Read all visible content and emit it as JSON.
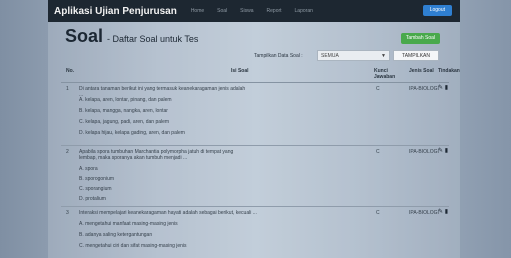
{
  "navbar": {
    "brand": "Aplikasi Ujian Penjurusan",
    "links": [
      "Home",
      "Soal",
      "Siswa",
      "Report",
      "Laporan"
    ],
    "logout_label": "Logout"
  },
  "page": {
    "title": "Soal",
    "subtitle": "- Daftar Soal untuk Tes",
    "add_button": "Tambah Soal",
    "filter_label": "Tampilkan Data Soal :",
    "filter_value": "SEMUA",
    "show_button": "TAMPILKAN"
  },
  "table": {
    "headers": {
      "no": "No.",
      "soal": "Isi Soal",
      "kunci_line1": "Kunci",
      "kunci_line2": "Jawaban",
      "jenis": "Jenis Soal",
      "tindakan": "Tindakan"
    },
    "rows": [
      {
        "no": "1",
        "question": "Di antara tanaman berikut ini yang termasuk keanekaragaman jenis adalah ...",
        "options": [
          "A. kelapa, aren, lontar, pinang, dan palem",
          "B. kelapa, mangga, nangka, aren, lontar",
          "C. kelapa, jagung, padi, aren, dan palem",
          "D. kelapa hijau, kelapa gading, aren, dan palem"
        ],
        "answer": "C",
        "jenis": "IPA-BIOLOGI"
      },
      {
        "no": "2",
        "question": "Apabila spora tumbuhan Marchantia polymorpha jatuh di tempat yang lembap, maka sporanya akan tumbuh menjadi ...",
        "options": [
          "A. spora",
          "B. sporogonium",
          "C. sporangium",
          "D. protalium"
        ],
        "answer": "C",
        "jenis": "IPA-BIOLOGI"
      },
      {
        "no": "3",
        "question": "Interaksi mempelajari keanekaragaman hayati adalah sebagai berikut, kecuali ...",
        "options": [
          "A. mengetahui manfaat masing-masing jenis",
          "B. adanya saling ketergantungan",
          "C. mengetahui ciri dan sifat masing-masing jenis"
        ],
        "answer": "C",
        "jenis": "IPA-BIOLOGI"
      }
    ],
    "action_icons": [
      "pencil-icon",
      "trash-icon"
    ]
  }
}
